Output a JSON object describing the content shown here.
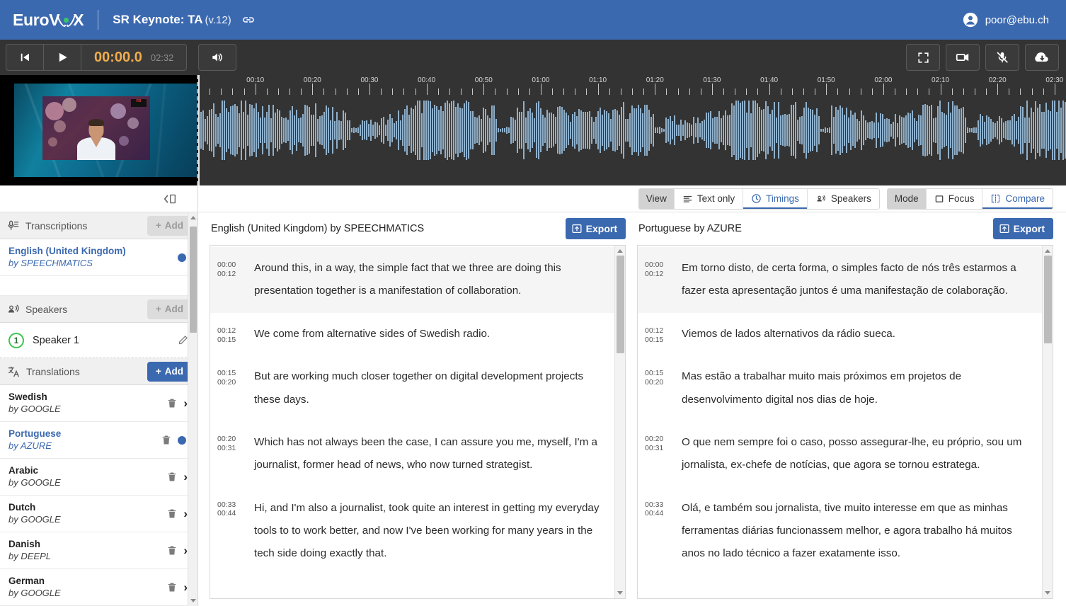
{
  "topbar": {
    "logo_pre": "EuroV",
    "logo_post": "X",
    "doc_title": "SR Keynote: TA",
    "doc_version": "(v.12)",
    "link_icon": "link-icon",
    "user_email": "poor@ebu.ch",
    "brand_color": "#3b69b0"
  },
  "player": {
    "skip_start_icon": "skip-to-start-icon",
    "play_icon": "play-icon",
    "current_time": "00:00.0",
    "duration": "02:32",
    "volume_icon": "volume-icon",
    "fullscreen_icon": "fullscreen-icon",
    "video_icon": "video-camera-icon",
    "mute_mic_icon": "microphone-muted-icon",
    "download_icon": "download-cloud-icon",
    "time_color": "#f0ad4e"
  },
  "timeline": {
    "labels": [
      "00:10",
      "00:20",
      "00:30",
      "00:40",
      "00:50",
      "01:00",
      "01:10",
      "01:20",
      "01:30",
      "01:40",
      "01:50",
      "02:00",
      "02:10",
      "02:20",
      "02:30"
    ],
    "total_seconds": 152,
    "waveform_color": "#8fb0cb"
  },
  "sidebar": {
    "collapse_icon": "collapse-panel-icon",
    "transcriptions": {
      "icon": "microphone-lines-icon",
      "title": "Transcriptions",
      "add_label": "Add",
      "add_enabled": false,
      "items": [
        {
          "name": "English (United Kingdom)",
          "engine": "by SPEECHMATICS",
          "selected": true
        }
      ]
    },
    "speakers": {
      "icon": "speakers-icon",
      "title": "Speakers",
      "add_label": "Add",
      "add_enabled": false,
      "items": [
        {
          "number": "1",
          "name": "Speaker 1",
          "edit_icon": "pencil-icon"
        }
      ]
    },
    "translations": {
      "icon": "translate-icon",
      "title": "Translations",
      "add_label": "Add",
      "add_enabled": true,
      "items": [
        {
          "name": "Swedish",
          "engine": "by GOOGLE",
          "selected": false
        },
        {
          "name": "Portuguese",
          "engine": "by AZURE",
          "selected": true
        },
        {
          "name": "Arabic",
          "engine": "by GOOGLE",
          "selected": false
        },
        {
          "name": "Dutch",
          "engine": "by GOOGLE",
          "selected": false
        },
        {
          "name": "Danish",
          "engine": "by DEEPL",
          "selected": false
        },
        {
          "name": "German",
          "engine": "by GOOGLE",
          "selected": false
        }
      ]
    }
  },
  "viewbar": {
    "view_label": "View",
    "view_options": [
      {
        "label": "Text only",
        "icon": "text-lines-icon",
        "active": false
      },
      {
        "label": "Timings",
        "icon": "clock-icon",
        "active": true
      },
      {
        "label": "Speakers",
        "icon": "speakers-icon",
        "active": false
      }
    ],
    "mode_label": "Mode",
    "mode_options": [
      {
        "label": "Focus",
        "icon": "square-icon",
        "active": false
      },
      {
        "label": "Compare",
        "icon": "compare-columns-icon",
        "active": true
      }
    ]
  },
  "panes": [
    {
      "title": "English (United Kingdom) by SPEECHMATICS",
      "export_label": "Export",
      "export_icon": "export-box-icon",
      "segments": [
        {
          "start": "00:00",
          "end": "00:12",
          "text": "Around this, in a way, the simple fact that we three are doing this presentation together is a manifestation of collaboration.",
          "highlight": true
        },
        {
          "start": "00:12",
          "end": "00:15",
          "text": "We come from alternative sides of Swedish radio.",
          "highlight": false
        },
        {
          "start": "00:15",
          "end": "00:20",
          "text": "But are working much closer together on digital development projects these days.",
          "highlight": false
        },
        {
          "start": "00:20",
          "end": "00:31",
          "text": "Which has not always been the case, I can assure you me, myself, I'm a journalist, former head of news, who now turned strategist.",
          "highlight": false
        },
        {
          "start": "00:33",
          "end": "00:44",
          "text": "Hi, and I'm also a journalist, took quite an interest in getting my everyday tools to to work better, and now I've been working for many years in the tech side doing exactly that.",
          "highlight": false
        }
      ]
    },
    {
      "title": "Portuguese by AZURE",
      "export_label": "Export",
      "export_icon": "export-box-icon",
      "segments": [
        {
          "start": "00:00",
          "end": "00:12",
          "text": "Em torno disto, de certa forma, o simples facto de nós três estarmos a fazer esta apresentação juntos é uma manifestação de colaboração.",
          "highlight": true
        },
        {
          "start": "00:12",
          "end": "00:15",
          "text": "Viemos de lados alternativos da rádio sueca.",
          "highlight": false
        },
        {
          "start": "00:15",
          "end": "00:20",
          "text": "Mas estão a trabalhar muito mais próximos em projetos de desenvolvimento digital nos dias de hoje.",
          "highlight": false
        },
        {
          "start": "00:20",
          "end": "00:31",
          "text": "O que nem sempre foi o caso, posso assegurar-lhe, eu próprio, sou um jornalista, ex-chefe de notícias, que agora se tornou estratega.",
          "highlight": false
        },
        {
          "start": "00:33",
          "end": "00:44",
          "text": "Olá, e também sou jornalista, tive muito interesse em que as minhas ferramentas diárias funcionassem melhor, e agora trabalho há muitos anos no lado técnico a fazer exatamente isso.",
          "highlight": false
        }
      ]
    }
  ]
}
